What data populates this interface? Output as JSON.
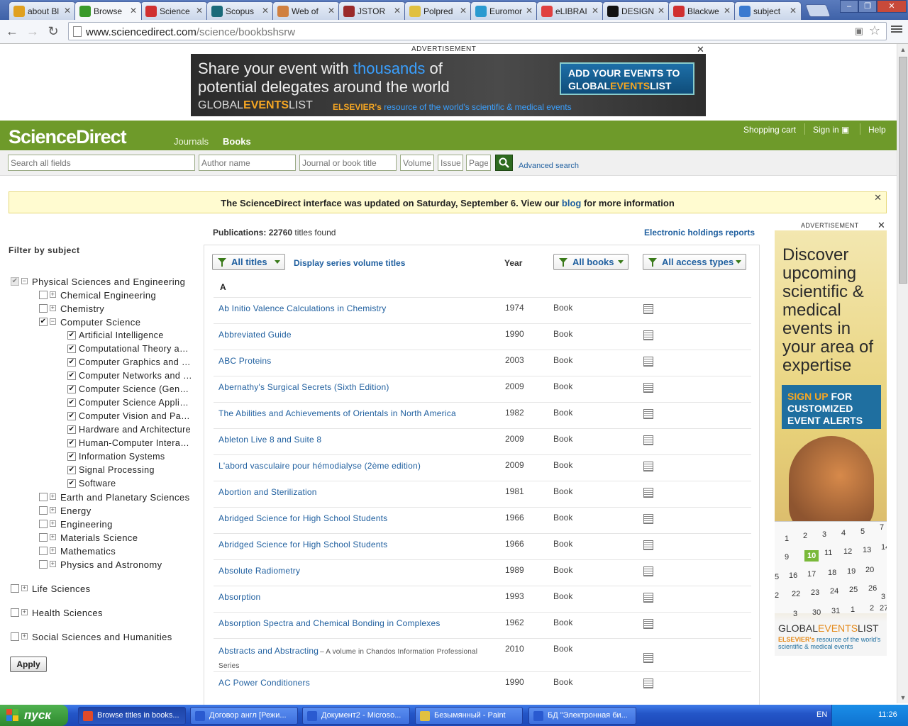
{
  "browser": {
    "tabs": [
      {
        "label": "about Bl",
        "icon_color": "#e0a020"
      },
      {
        "label": "Browse",
        "icon_color": "#3a9a2a"
      },
      {
        "label": "Science",
        "icon_color": "#d03030"
      },
      {
        "label": "Scopus",
        "icon_color": "#1a6a7a"
      },
      {
        "label": "Web of",
        "icon_color": "#d08040"
      },
      {
        "label": "JSTOR",
        "icon_color": "#9a2a2a"
      },
      {
        "label": "Polpred",
        "icon_color": "#e0c040"
      },
      {
        "label": "Euromor",
        "icon_color": "#2a9ad0"
      },
      {
        "label": "eLIBRAI",
        "icon_color": "#e04040"
      },
      {
        "label": "DESIGNI",
        "icon_color": "#111111"
      },
      {
        "label": "Blackwe",
        "icon_color": "#d03030"
      },
      {
        "label": "subject",
        "icon_color": "#3a7ad0"
      }
    ],
    "url_host": "www.sciencedirect.com",
    "url_path": "/science/bookbshsrw"
  },
  "ad_top": {
    "label": "ADVERTISEMENT",
    "line1_pre": "Share your event with ",
    "line1_hi": "thousands",
    "line1_post": " of",
    "line2": "potential delegates around the world",
    "brand_a": "GLOBAL",
    "brand_b": "EVENTS",
    "brand_c": "LIST",
    "els_a": "ELSEVIER's",
    "els_b": " resource of the world's scientific & medical events",
    "btn_l1": "ADD YOUR EVENTS TO",
    "btn_a": "GLOBAL",
    "btn_b": "EVENTS",
    "btn_c": "LIST"
  },
  "header": {
    "logo": "ScienceDirect",
    "nav_journals": "Journals",
    "nav_books": "Books",
    "shopping_cart": "Shopping cart",
    "sign_in": "Sign in",
    "help": "Help"
  },
  "search": {
    "all_fields": "Search all fields",
    "author": "Author name",
    "journal": "Journal or book title",
    "volume": "Volume",
    "issue": "Issue",
    "page": "Page",
    "advanced": "Advanced search"
  },
  "notice": {
    "text_pre": "The ScienceDirect interface was updated on Saturday, September 6. View our ",
    "link": "blog",
    "text_post": " for more information"
  },
  "filter": {
    "title": "Filter by subject",
    "apply": "Apply",
    "top": [
      {
        "label": "Physical Sciences and Engineering",
        "checked": true,
        "expanded": true
      },
      {
        "label": "Life Sciences",
        "checked": false,
        "expanded": false
      },
      {
        "label": "Health Sciences",
        "checked": false,
        "expanded": false
      },
      {
        "label": "Social Sciences and Humanities",
        "checked": false,
        "expanded": false
      }
    ],
    "level2": [
      {
        "label": "Chemical Engineering",
        "checked": false,
        "expanded": false
      },
      {
        "label": "Chemistry",
        "checked": false,
        "expanded": false
      },
      {
        "label": "Computer Science",
        "checked": true,
        "expanded": true
      },
      {
        "label": "Earth and Planetary Sciences",
        "checked": false,
        "expanded": false
      },
      {
        "label": "Energy",
        "checked": false,
        "expanded": false
      },
      {
        "label": "Engineering",
        "checked": false,
        "expanded": false
      },
      {
        "label": "Materials Science",
        "checked": false,
        "expanded": false
      },
      {
        "label": "Mathematics",
        "checked": false,
        "expanded": false
      },
      {
        "label": "Physics and Astronomy",
        "checked": false,
        "expanded": false
      }
    ],
    "level3": [
      {
        "label": "Artificial Intelligence",
        "checked": true
      },
      {
        "label": "Computational Theory and M…",
        "checked": true
      },
      {
        "label": "Computer Graphics and Co…",
        "checked": true
      },
      {
        "label": "Computer Networks and Co…",
        "checked": true
      },
      {
        "label": "Computer Science (General)",
        "checked": true
      },
      {
        "label": "Computer Science Applicati…",
        "checked": true
      },
      {
        "label": "Computer Vision and Patter…",
        "checked": true
      },
      {
        "label": "Hardware and Architecture",
        "checked": true
      },
      {
        "label": "Human-Computer Interaction",
        "checked": true
      },
      {
        "label": "Information Systems",
        "checked": true
      },
      {
        "label": "Signal Processing",
        "checked": true
      },
      {
        "label": "Software",
        "checked": true
      }
    ]
  },
  "results": {
    "count_label": "Publications:",
    "count_value": "22760",
    "count_suffix": " titles found",
    "holdings": "Electronic holdings reports",
    "all_titles": "All titles",
    "series_link": "Display series volume titles",
    "year_header": "Year",
    "all_books": "All books",
    "all_access": "All access types",
    "letter": "A",
    "rows": [
      {
        "title": "Ab Initio Valence Calculations in Chemistry",
        "year": "1974",
        "type": "Book"
      },
      {
        "title": "Abbreviated Guide",
        "year": "1990",
        "type": "Book"
      },
      {
        "title": "ABC Proteins",
        "year": "2003",
        "type": "Book"
      },
      {
        "title": "Abernathy's Surgical Secrets (Sixth Edition)",
        "year": "2009",
        "type": "Book"
      },
      {
        "title": "The Abilities and Achievements of Orientals in North America",
        "year": "1982",
        "type": "Book"
      },
      {
        "title": "Ableton Live 8 and Suite 8",
        "year": "2009",
        "type": "Book"
      },
      {
        "title": "L'abord vasculaire pour hémodialyse (2ème edition)",
        "year": "2009",
        "type": "Book"
      },
      {
        "title": "Abortion and Sterilization",
        "year": "1981",
        "type": "Book"
      },
      {
        "title": "Abridged Science for High School Students",
        "year": "1966",
        "type": "Book"
      },
      {
        "title": "Abridged Science for High School Students",
        "year": "1966",
        "type": "Book"
      },
      {
        "title": "Absolute Radiometry",
        "year": "1989",
        "type": "Book"
      },
      {
        "title": "Absorption",
        "year": "1993",
        "type": "Book"
      },
      {
        "title": "Absorption Spectra and Chemical Bonding in Complexes",
        "year": "1962",
        "type": "Book"
      },
      {
        "title": "Abstracts and Abstracting",
        "series": "– A volume in Chandos Information Professional Series",
        "year": "2010",
        "type": "Book"
      },
      {
        "title": "AC Power Conditioners",
        "year": "1990",
        "type": "Book"
      }
    ]
  },
  "ad_right": {
    "label": "ADVERTISEMENT",
    "headline": "Discover upcoming scientific & medical events in your area of expertise",
    "signup_a": "SIGN UP",
    "signup_b": " FOR CUSTOMIZED EVENT ALERTS",
    "calendar": [
      "1",
      "2",
      "3",
      "4",
      "5",
      "7",
      "9",
      "10",
      "11",
      "12",
      "13",
      "14",
      "5",
      "16",
      "17",
      "18",
      "19",
      "20",
      "2",
      "22",
      "23",
      "24",
      "25",
      "26",
      "27",
      "3",
      "30",
      "31",
      "1",
      "2",
      "3"
    ],
    "brand_a": "GLOBAL",
    "brand_b": "EVENTS",
    "brand_c": "LIST",
    "els_a": "ELSEVIER's",
    "els_b": " resource of the world's scientific & medical events"
  },
  "taskbar": {
    "start": "пуск",
    "items": [
      "Browse titles in books...",
      "Договор англ [Режи...",
      "Документ2 - Microso...",
      "Безымянный - Paint",
      "БД \"Электронная би..."
    ],
    "lang": "EN",
    "time": "11:26"
  }
}
